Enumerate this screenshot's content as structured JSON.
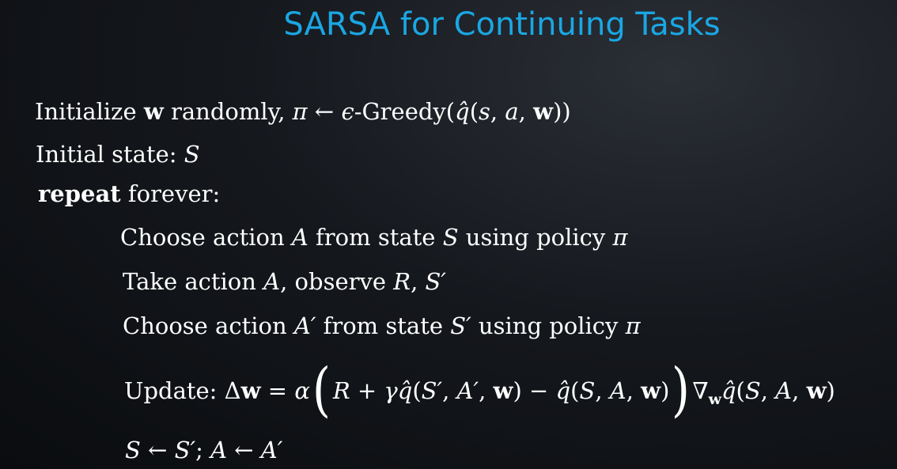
{
  "title": "SARSA for Continuing Tasks",
  "algorithm": {
    "line_init": {
      "text_before": "Initialize ",
      "w": "w",
      "text_mid": " randomly, ",
      "pi": "π",
      "arrow": " ← ",
      "eps": "ϵ",
      "greedy": "-Greedy(",
      "qhat": "q̂",
      "args_open": "(",
      "s": "s",
      "comma1": ", ",
      "a": "a",
      "comma2": ", ",
      "w2": "w",
      "args_close": "))"
    },
    "line_state": {
      "text": "Initial state:  ",
      "S": "S"
    },
    "line_repeat": {
      "keyword": "repeat",
      "text": " forever:"
    },
    "line_choose1": {
      "t1": "Choose action ",
      "A": "A",
      "t2": " from state ",
      "S": "S",
      "t3": " using policy ",
      "pi": "π"
    },
    "line_take": {
      "t1": "Take action ",
      "A": "A",
      "t2": ", observe ",
      "R": "R",
      "comma": ", ",
      "S": "S′"
    },
    "line_choose2": {
      "t1": "Choose action ",
      "A": "A′",
      "t2": " from state ",
      "S": "S′",
      "t3": " using policy ",
      "pi": "π"
    },
    "line_update": {
      "label": "Update:  ",
      "delta": "Δ",
      "w": "w",
      "eq": " = ",
      "alpha": "α",
      "lparen": "(",
      "R": "R",
      "plus": " + ",
      "gamma": "γ",
      "qhat1": "q̂",
      "args1_open": "(",
      "S1": "S′",
      "c1": ", ",
      "A1": "A′",
      "c2": ", ",
      "w1": "w",
      "args1_close": ")",
      "minus": " − ",
      "qhat2": "q̂",
      "args2_open": "(",
      "S2": "S",
      "c3": ", ",
      "A2": "A",
      "c4": ", ",
      "w2": "w",
      "args2_close": ")",
      "rparen": ")",
      "nabla": "∇",
      "wsub": "w",
      "qhat3": "q̂",
      "args3_open": "(",
      "S3": "S",
      "c5": ", ",
      "A3": "A",
      "c6": ", ",
      "w3": "w",
      "args3_close": ")"
    },
    "line_assign": {
      "S": "S",
      "arrow1": " ← ",
      "S2": "S′",
      "semi": "; ",
      "A": "A",
      "arrow2": " ← ",
      "A2": "A′"
    }
  }
}
